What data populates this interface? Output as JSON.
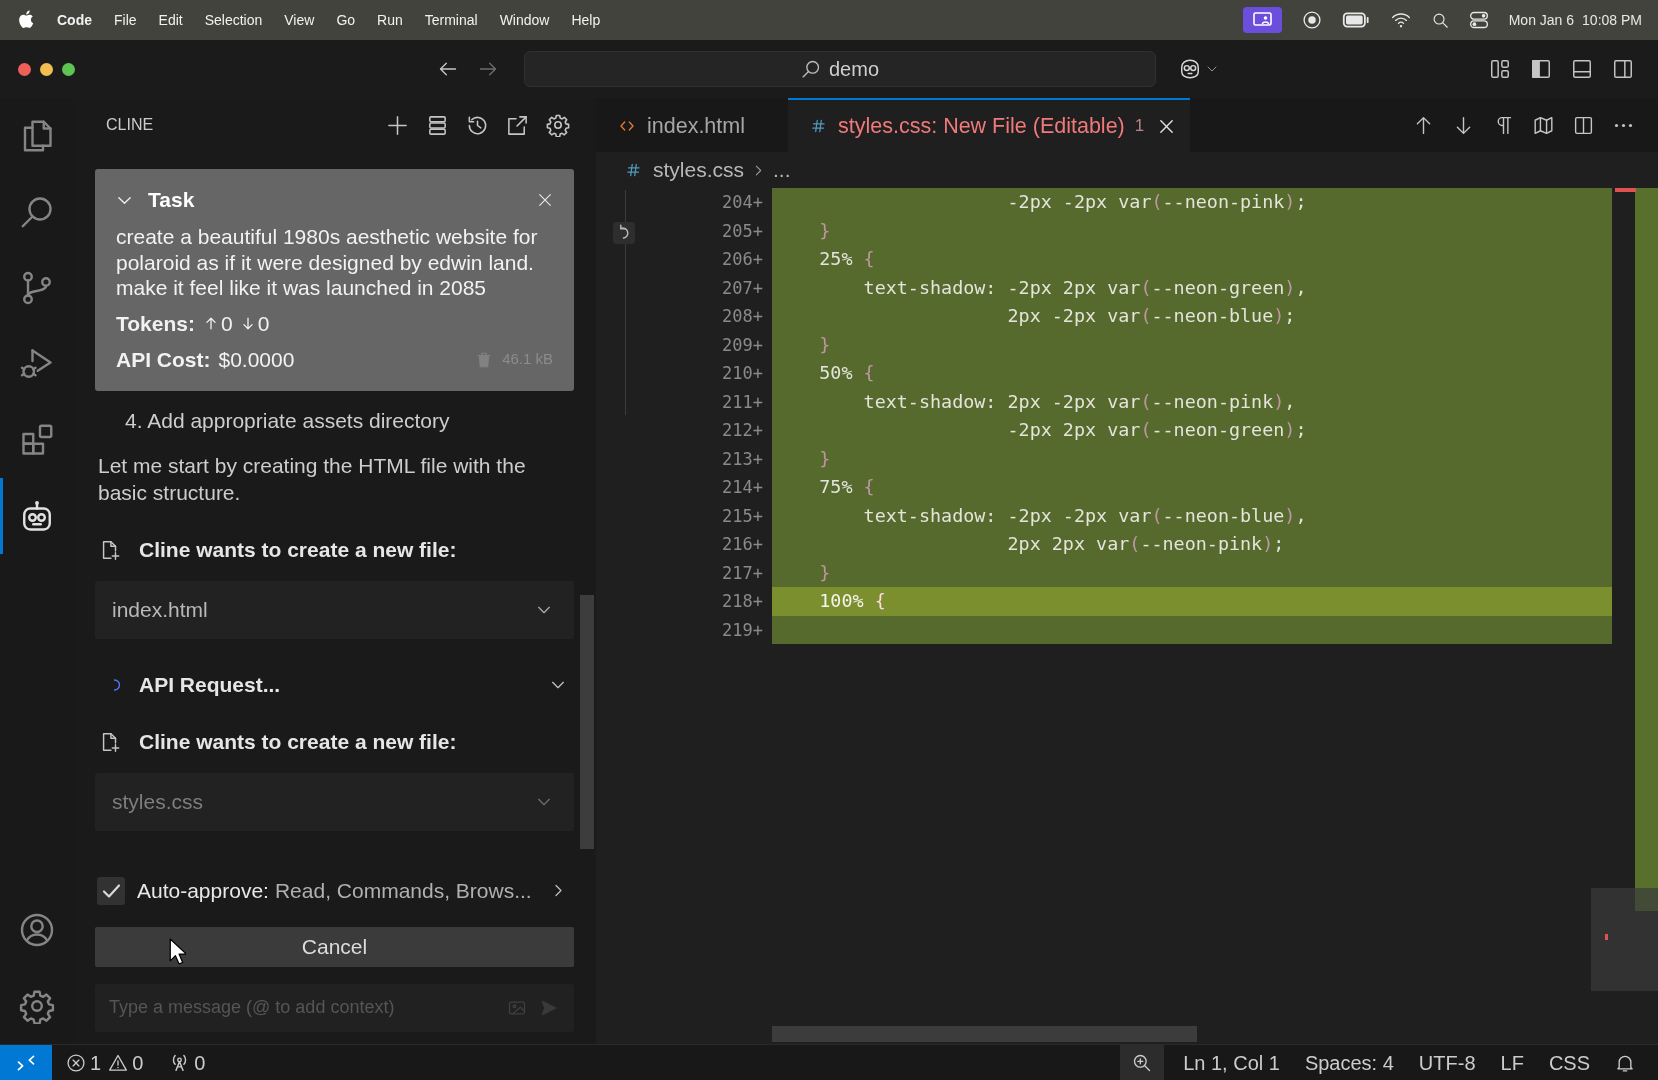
{
  "menu_bar": {
    "app": "Code",
    "menus": [
      "File",
      "Edit",
      "Selection",
      "View",
      "Go",
      "Run",
      "Terminal",
      "Window",
      "Help"
    ],
    "date": "Mon Jan 6",
    "time": "10:08 PM"
  },
  "title_bar": {
    "search": {
      "value": "demo"
    }
  },
  "activity_bar": {
    "items": [
      {
        "selected": false
      },
      {
        "selected": false
      },
      {
        "selected": false
      },
      {
        "selected": false
      },
      {
        "selected": false
      },
      {
        "selected": true
      }
    ]
  },
  "side_panel": {
    "title": "CLINE",
    "task": {
      "expanded": true,
      "title": "Task",
      "text": "create a beautiful 1980s aesthetic website for polaroid as if it were designed by edwin land. make it feel like it was launched in 2085",
      "tokens": {
        "label": "Tokens:",
        "up": "0",
        "down": "0"
      },
      "cost": {
        "label": "API Cost:",
        "value": "$0.0000"
      },
      "size": "46.1 kB"
    },
    "messages": [
      {
        "kind": "list_item",
        "text": "4. Add appropriate assets directory"
      },
      {
        "kind": "paragraph",
        "text": "Let me start by creating the HTML file with the basic structure."
      },
      {
        "kind": "tool",
        "text": "Cline wants to create a new file:"
      },
      {
        "kind": "file",
        "text": "index.html",
        "disabled": false
      },
      {
        "kind": "request",
        "text": "API Request..."
      },
      {
        "kind": "tool",
        "text": "Cline wants to create a new file:"
      },
      {
        "kind": "file",
        "text": "styles.css",
        "disabled": true
      }
    ],
    "auto_approve": {
      "checked": true,
      "label": "Auto-approve:",
      "value": "Read, Commands, Brows..."
    },
    "cancel_button": "Cancel",
    "input": {
      "placeholder": "Type a message (@ to add context)"
    }
  },
  "editor": {
    "tabs": [
      {
        "kind": "html",
        "label": "index.html",
        "selected": false,
        "errors": false
      },
      {
        "kind": "css",
        "label": "styles.css: New File (Editable)",
        "selected": true,
        "errors": true,
        "badge": "1"
      }
    ],
    "breadcrumb": {
      "kind": "css",
      "items": [
        "styles.css",
        "..."
      ]
    },
    "code": {
      "lines": [
        {
          "number": "204+",
          "highlighted": false,
          "segments": [
            {
              "kind": "code",
              "text": "                     -2px -2px var"
            },
            {
              "kind": "bracket",
              "text": "("
            },
            {
              "kind": "code",
              "text": "--neon-pink"
            },
            {
              "kind": "bracket",
              "text": ")"
            },
            {
              "kind": "code",
              "text": ";"
            }
          ]
        },
        {
          "number": "205+",
          "highlighted": false,
          "segments": [
            {
              "kind": "bracket",
              "text": "    }"
            }
          ]
        },
        {
          "number": "206+",
          "highlighted": false,
          "segments": [
            {
              "kind": "code",
              "text": "    25% "
            },
            {
              "kind": "bracket",
              "text": "{"
            }
          ]
        },
        {
          "number": "207+",
          "highlighted": false,
          "segments": [
            {
              "kind": "code",
              "text": "        text-shadow: -2px 2px var"
            },
            {
              "kind": "bracket",
              "text": "("
            },
            {
              "kind": "code",
              "text": "--neon-green"
            },
            {
              "kind": "bracket",
              "text": ")"
            },
            {
              "kind": "code",
              "text": ","
            }
          ]
        },
        {
          "number": "208+",
          "highlighted": false,
          "segments": [
            {
              "kind": "code",
              "text": "                     2px -2px var"
            },
            {
              "kind": "bracket",
              "text": "("
            },
            {
              "kind": "code",
              "text": "--neon-blue"
            },
            {
              "kind": "bracket",
              "text": ")"
            },
            {
              "kind": "code",
              "text": ";"
            }
          ]
        },
        {
          "number": "209+",
          "highlighted": false,
          "segments": [
            {
              "kind": "bracket",
              "text": "    }"
            }
          ]
        },
        {
          "number": "210+",
          "highlighted": false,
          "segments": [
            {
              "kind": "code",
              "text": "    50% "
            },
            {
              "kind": "bracket",
              "text": "{"
            }
          ]
        },
        {
          "number": "211+",
          "highlighted": false,
          "segments": [
            {
              "kind": "code",
              "text": "        text-shadow: 2px -2px var"
            },
            {
              "kind": "bracket",
              "text": "("
            },
            {
              "kind": "code",
              "text": "--neon-pink"
            },
            {
              "kind": "bracket",
              "text": ")"
            },
            {
              "kind": "code",
              "text": ","
            }
          ]
        },
        {
          "number": "212+",
          "highlighted": false,
          "segments": [
            {
              "kind": "code",
              "text": "                     -2px 2px var"
            },
            {
              "kind": "bracket",
              "text": "("
            },
            {
              "kind": "code",
              "text": "--neon-green"
            },
            {
              "kind": "bracket",
              "text": ")"
            },
            {
              "kind": "code",
              "text": ";"
            }
          ]
        },
        {
          "number": "213+",
          "highlighted": false,
          "segments": [
            {
              "kind": "bracket",
              "text": "    }"
            }
          ]
        },
        {
          "number": "214+",
          "highlighted": false,
          "segments": [
            {
              "kind": "code",
              "text": "    75% "
            },
            {
              "kind": "bracket",
              "text": "{"
            }
          ]
        },
        {
          "number": "215+",
          "highlighted": false,
          "segments": [
            {
              "kind": "code",
              "text": "        text-shadow: -2px -2px var"
            },
            {
              "kind": "bracket",
              "text": "("
            },
            {
              "kind": "code",
              "text": "--neon-blue"
            },
            {
              "kind": "bracket",
              "text": ")"
            },
            {
              "kind": "code",
              "text": ","
            }
          ]
        },
        {
          "number": "216+",
          "highlighted": false,
          "segments": [
            {
              "kind": "code",
              "text": "                     2px 2px var"
            },
            {
              "kind": "bracket",
              "text": "("
            },
            {
              "kind": "code",
              "text": "--neon-pink"
            },
            {
              "kind": "bracket",
              "text": ")"
            },
            {
              "kind": "code",
              "text": ";"
            }
          ]
        },
        {
          "number": "217+",
          "highlighted": false,
          "segments": [
            {
              "kind": "bracket",
              "text": "    }"
            }
          ]
        },
        {
          "number": "218+",
          "highlighted": true,
          "segments": [
            {
              "kind": "code",
              "text": "    100% "
            },
            {
              "kind": "bracket",
              "text": "{"
            }
          ]
        },
        {
          "number": "219+",
          "highlighted": false
        }
      ]
    }
  },
  "status_bar": {
    "errors": "1",
    "warnings": "0",
    "ports": "0",
    "items": [
      "Ln 1, Col 1",
      "Spaces: 4",
      "UTF-8",
      "LF",
      "CSS"
    ]
  }
}
